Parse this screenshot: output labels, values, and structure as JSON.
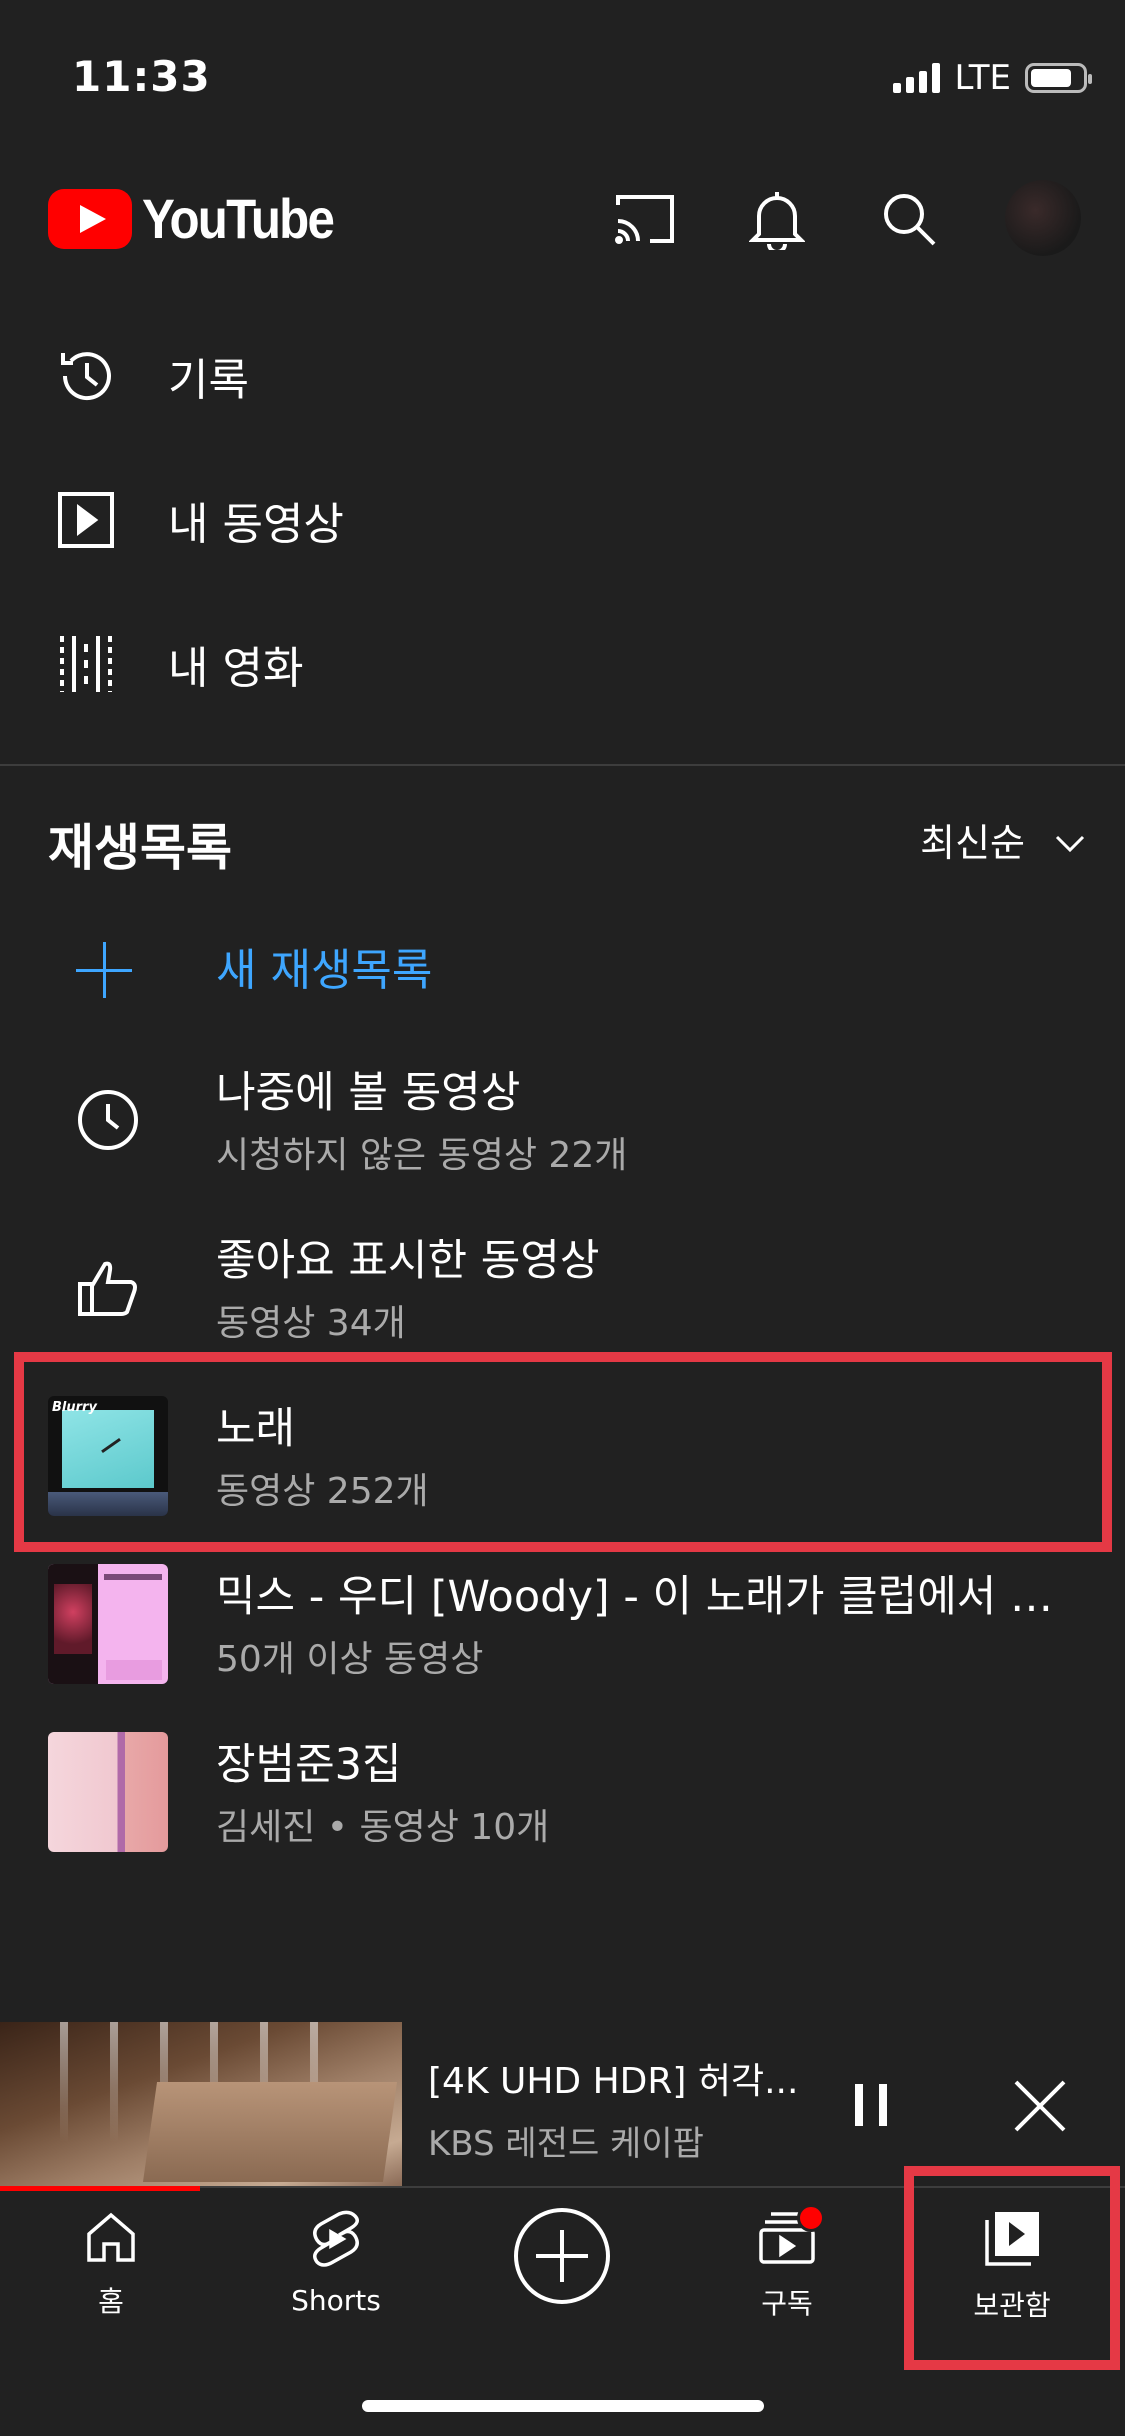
{
  "status": {
    "time": "11:33",
    "network": "LTE"
  },
  "header": {
    "logo_text": "YouTube"
  },
  "menu": [
    {
      "label": "기록",
      "icon": "history-icon"
    },
    {
      "label": "내 동영상",
      "icon": "play-square-icon"
    },
    {
      "label": "내 영화",
      "icon": "film-icon"
    }
  ],
  "playlists": {
    "title": "재생목록",
    "sort_label": "최신순",
    "new_label": "새 재생목록",
    "items": [
      {
        "title": "나중에 볼 동영상",
        "sub": "시청하지 않은 동영상 22개",
        "icon": "clock-icon"
      },
      {
        "title": "좋아요 표시한 동영상",
        "sub": "동영상 34개",
        "icon": "thumbs-up-icon"
      },
      {
        "title": "노래",
        "sub": "동영상 252개",
        "thumb_text": "Blurry"
      },
      {
        "title": "믹스 - 우디 [Woody] - 이 노래가 클럽에서 나온다면",
        "sub": "50개 이상 동영상"
      },
      {
        "title": "장범준3집",
        "sub": "김세진 • 동영상 10개"
      }
    ]
  },
  "mini_player": {
    "title": "[4K UHD HDR] 허각...",
    "channel": "KBS 레전드 케이팝"
  },
  "nav": [
    {
      "label": "홈"
    },
    {
      "label": "Shorts"
    },
    {
      "label": ""
    },
    {
      "label": "구독"
    },
    {
      "label": "보관함"
    }
  ],
  "colors": {
    "background": "#212121",
    "accent_blue": "#3ea6ff",
    "brand_red": "#ff0000",
    "highlight_red": "#e53945"
  }
}
